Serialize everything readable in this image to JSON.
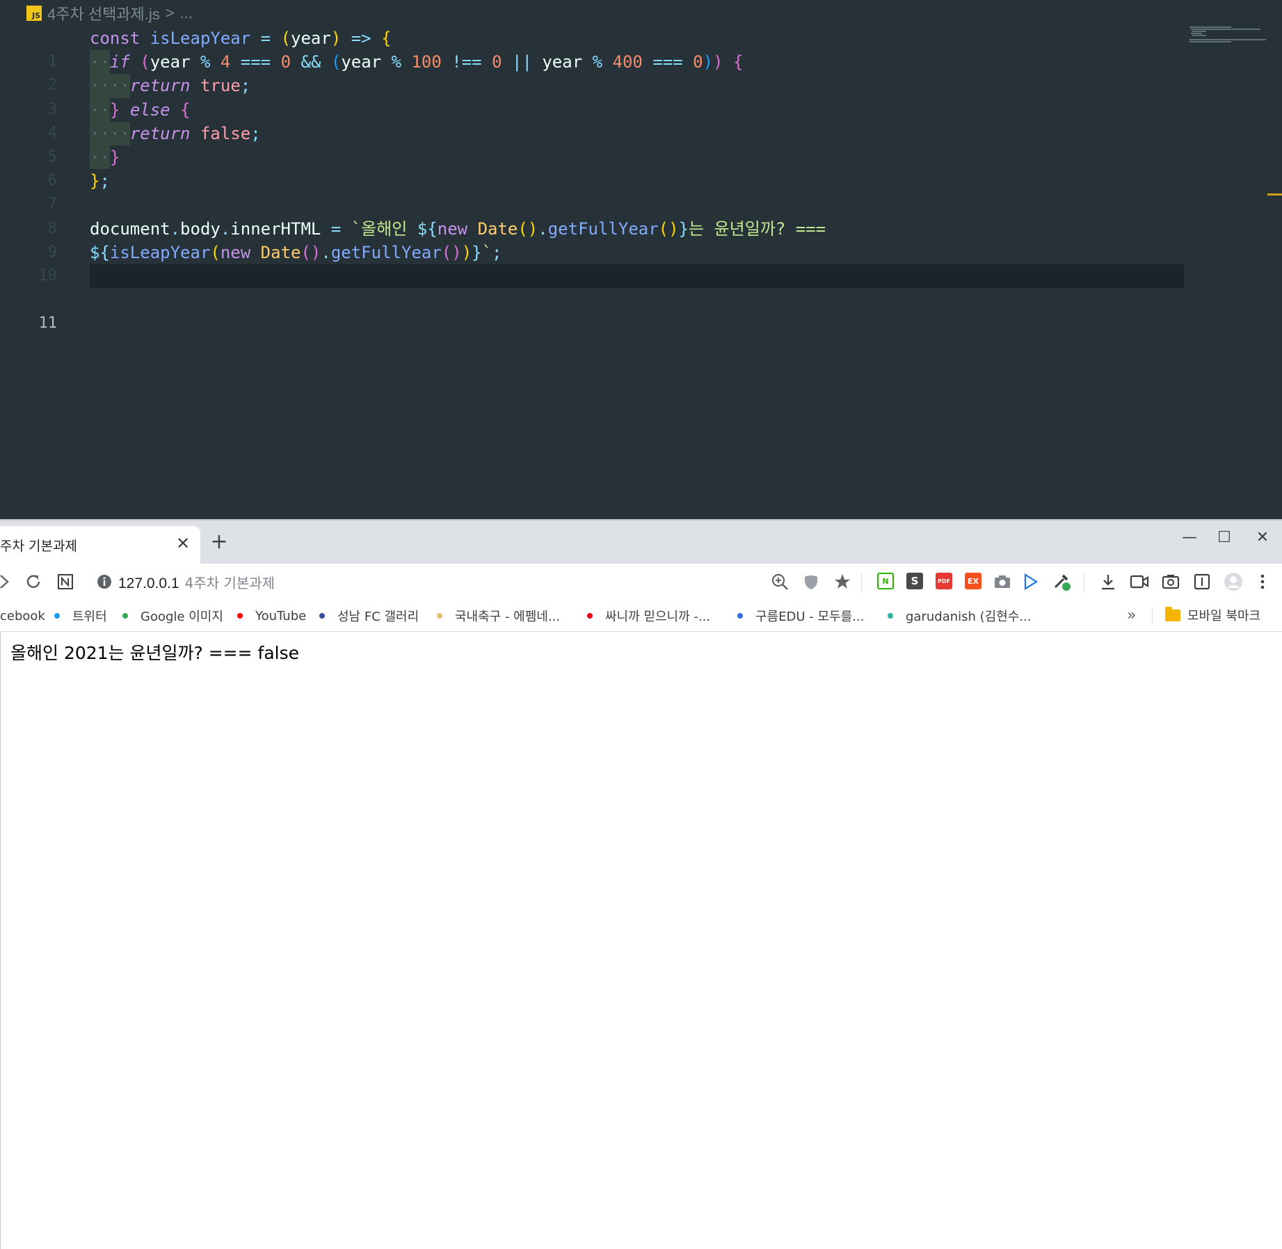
{
  "editor": {
    "breadcrumb": {
      "icon_label": "JS",
      "file": "4주차 선택과제.js",
      "separator": ">",
      "rest": "..."
    },
    "line_numbers": [
      "1",
      "2",
      "3",
      "4",
      "5",
      "6",
      "7",
      "8",
      "9",
      "10",
      "11"
    ],
    "current_line": 11,
    "code_lines": [
      "const isLeapYear = (year) => {",
      "  if (year % 4 === 0 && (year % 100 !== 0 || year % 400 === 0)) {",
      "    return true;",
      "  } else {",
      "    return false;",
      "  }",
      "};",
      "",
      "document.body.innerHTML = `올해인 ${new Date().getFullYear()}는 윤년일까? ===",
      "${isLeapYear(new Date().getFullYear())}`;",
      ""
    ],
    "colors": {
      "background": "#263238",
      "keyword": "#c792ea",
      "function": "#82aaff",
      "number": "#f78c6c",
      "string": "#c3e88d",
      "operator": "#89ddff",
      "class": "#ffcb6b"
    }
  },
  "browser": {
    "tab": {
      "title": "주차 기본과제",
      "close_icon": "close-icon"
    },
    "new_tab": "+",
    "window_controls": {
      "minimize": "—",
      "maximize": "☐",
      "close": "✕"
    },
    "toolbar": {
      "url_host": "127.0.0.1",
      "url_title": "4주차 기본과제",
      "icons": [
        "forward-icon",
        "reload-icon",
        "notion-icon",
        "info-icon",
        "zoom-icon",
        "shield-icon",
        "star-icon",
        "naver-ext-icon",
        "s-ext-icon",
        "pdf-ext-icon",
        "ex-ext-icon",
        "camera-ext-icon",
        "play-ext-icon",
        "eyedropper-ext-icon",
        "download-icon",
        "video-icon",
        "screenshot-icon",
        "reader-icon",
        "profile-icon",
        "menu-icon"
      ],
      "ext_labels": {
        "naver": "N",
        "s": "S",
        "pdf": "PDF",
        "ex": "EX"
      }
    },
    "bookmarks": [
      {
        "label": "cebook",
        "dot": ""
      },
      {
        "label": "트위터",
        "dot": "#1d9bf0"
      },
      {
        "label": "Google 이미지",
        "dot": "#34a853"
      },
      {
        "label": "YouTube",
        "dot": "#ff0000"
      },
      {
        "label": "성남 FC 갤러리",
        "dot": "#3b4a9c"
      },
      {
        "label": "국내축구 - 에펨네...",
        "dot": "#e2c27a"
      },
      {
        "label": "싸니까 믿으니까 -...",
        "dot": "#e60012"
      },
      {
        "label": "구름EDU - 모두를...",
        "dot": "#2f6de1"
      },
      {
        "label": "garudanish (김현수...",
        "dot": "#2bb5a0"
      }
    ],
    "bookmarks_more": "»",
    "mobile_bookmarks": "모바일 북마크",
    "page_content": "올해인 2021는 윤년일까? === false"
  }
}
